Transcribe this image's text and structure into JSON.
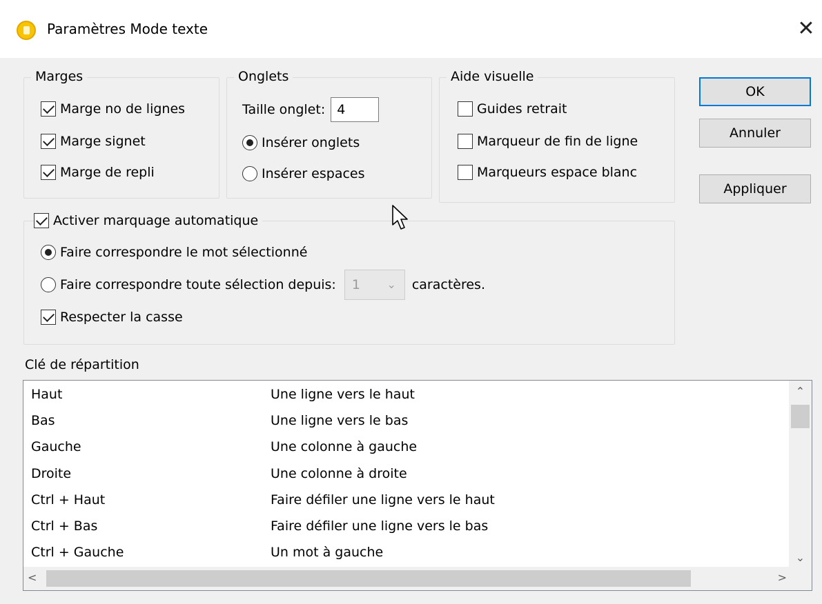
{
  "window": {
    "title": "Paramètres Mode texte",
    "close_glyph": "✕",
    "app_icon": "app-icon"
  },
  "margins": {
    "legend": "Marges",
    "items": [
      {
        "label": "Marge no de lignes",
        "checked": true
      },
      {
        "label": "Marge signet",
        "checked": true
      },
      {
        "label": "Marge de repli",
        "checked": true
      }
    ]
  },
  "tabs": {
    "legend": "Onglets",
    "size_label": "Taille onglet:",
    "size_value": "4",
    "insert_tabs": "Insérer onglets",
    "insert_spaces": "Insérer espaces",
    "selected": "insert_tabs"
  },
  "visual_aid": {
    "legend": "Aide visuelle",
    "items": [
      {
        "label": "Guides retrait",
        "checked": false
      },
      {
        "label": "Marqueur de fin de ligne",
        "checked": false
      },
      {
        "label": "Marqueurs espace blanc",
        "checked": false
      }
    ]
  },
  "buttons": {
    "ok": "OK",
    "cancel": "Annuler",
    "apply": "Appliquer"
  },
  "auto_highlight": {
    "legend": "Activer marquage automatique",
    "enabled": true,
    "match_word": "Faire correspondre le mot sélectionné",
    "match_selection": "Faire correspondre toute sélection depuis:",
    "combo_value": "1",
    "characters": "caractères.",
    "case_sensitive": "Respecter la casse",
    "case_checked": true,
    "selected": "match_word"
  },
  "keymap": {
    "label": "Clé de répartition",
    "rows": [
      {
        "key": "Haut",
        "action": "Une ligne vers le haut"
      },
      {
        "key": "Bas",
        "action": "Une ligne vers le bas"
      },
      {
        "key": "Gauche",
        "action": "Une colonne à gauche"
      },
      {
        "key": "Droite",
        "action": "Une colonne à droite"
      },
      {
        "key": "Ctrl + Haut",
        "action": "Faire défiler une ligne vers le haut"
      },
      {
        "key": "Ctrl + Bas",
        "action": "Faire défiler une ligne vers le bas"
      },
      {
        "key": "Ctrl + Gauche",
        "action": "Un mot à gauche"
      }
    ]
  },
  "colors": {
    "dialog_bg": "#f0f0f0",
    "titlebar_bg": "#ffffff",
    "default_button_border": "#0078d7",
    "app_icon": "#f8c400"
  }
}
